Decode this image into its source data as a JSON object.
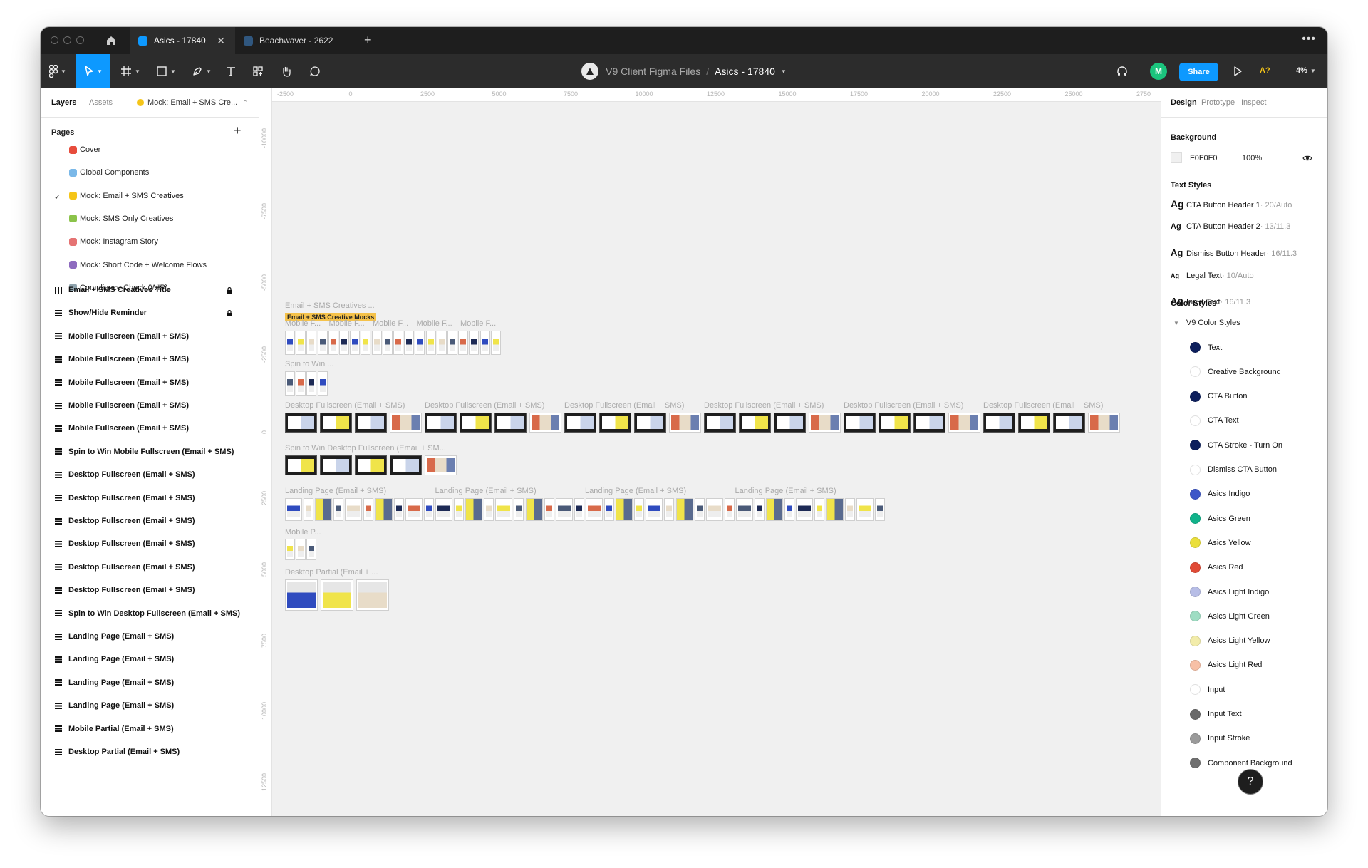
{
  "titlebar": {
    "tabs": [
      {
        "label": "Asics - 17840",
        "active": true
      },
      {
        "label": "Beachwaver - 2622",
        "active": false
      }
    ]
  },
  "header": {
    "project": "V9 Client Figma Files",
    "separator": "/",
    "file": "Asics - 17840",
    "avatar_initial": "M",
    "share_label": "Share",
    "a11y_label": "A?",
    "zoom": "4%"
  },
  "left_panel": {
    "tabs": [
      "Layers",
      "Assets"
    ],
    "current_page": "Mock: Email + SMS Cre...",
    "pages_title": "Pages",
    "pages": [
      {
        "label": "Cover",
        "emoji_color": "#e74c3c"
      },
      {
        "label": "Global Components",
        "emoji_color": "#7ab8e8"
      },
      {
        "label": "Mock: Email + SMS Creatives",
        "emoji_color": "#f5c518",
        "current": true
      },
      {
        "label": "Mock: SMS Only Creatives",
        "emoji_color": "#8bc34a"
      },
      {
        "label": "Mock: Instagram Story",
        "emoji_color": "#e57373"
      },
      {
        "label": "Mock: Short Code + Welcome Flows",
        "emoji_color": "#8e6bbf"
      },
      {
        "label": "Compliance Check (WIP)",
        "emoji_color": "#90a4ae"
      }
    ],
    "layers": [
      {
        "label": "Email + SMS Creatives Title",
        "locked": true,
        "icon": "columns"
      },
      {
        "label": "Show/Hide Reminder",
        "locked": true,
        "icon": "rows"
      },
      {
        "label": "Mobile Fullscreen (Email + SMS)",
        "icon": "rows"
      },
      {
        "label": "Mobile Fullscreen (Email + SMS)",
        "icon": "rows"
      },
      {
        "label": "Mobile Fullscreen (Email + SMS)",
        "icon": "rows"
      },
      {
        "label": "Mobile Fullscreen (Email + SMS)",
        "icon": "rows"
      },
      {
        "label": "Mobile Fullscreen (Email + SMS)",
        "icon": "rows"
      },
      {
        "label": "Spin to Win Mobile Fullscreen (Email + SMS)",
        "icon": "rows"
      },
      {
        "label": "Desktop Fullscreen (Email + SMS)",
        "icon": "rows"
      },
      {
        "label": "Desktop Fullscreen (Email + SMS)",
        "icon": "rows"
      },
      {
        "label": "Desktop Fullscreen (Email + SMS)",
        "icon": "rows"
      },
      {
        "label": "Desktop Fullscreen (Email + SMS)",
        "icon": "rows"
      },
      {
        "label": "Desktop Fullscreen (Email + SMS)",
        "icon": "rows"
      },
      {
        "label": "Desktop Fullscreen (Email + SMS)",
        "icon": "rows"
      },
      {
        "label": "Spin to Win Desktop Fullscreen (Email + SMS)",
        "icon": "rows"
      },
      {
        "label": "Landing Page (Email + SMS)",
        "icon": "rows"
      },
      {
        "label": "Landing Page (Email + SMS)",
        "icon": "rows"
      },
      {
        "label": "Landing Page (Email + SMS)",
        "icon": "rows"
      },
      {
        "label": "Landing Page (Email + SMS)",
        "icon": "rows"
      },
      {
        "label": "Mobile Partial (Email + SMS)",
        "icon": "rows"
      },
      {
        "label": "Desktop Partial (Email + SMS)",
        "icon": "rows"
      }
    ]
  },
  "canvas": {
    "ruler_top": [
      "-2500",
      "0",
      "2500",
      "5000",
      "7500",
      "10000",
      "12500",
      "15000",
      "17500",
      "20000",
      "22500",
      "25000",
      "2750"
    ],
    "ruler_left": [
      "-10000",
      "-7500",
      "-5000",
      "-2500",
      "0",
      "2500",
      "5000",
      "7500",
      "10000",
      "12500"
    ],
    "section_title": "Email + SMS Creatives ...",
    "section_tag": "Email + SMS Creative Mocks",
    "mobile_labels": [
      "Mobile F...",
      "Mobile F...",
      "Mobile F...",
      "Mobile F...",
      "Mobile F..."
    ],
    "spin_mobile_label": "Spin to Win ...",
    "desktop_labels": [
      "Desktop Fullscreen (Email + SMS)",
      "Desktop Fullscreen (Email + SMS)",
      "Desktop Fullscreen (Email + SMS)",
      "Desktop Fullscreen (Email + SMS)",
      "Desktop Fullscreen (Email + SMS)",
      "Desktop Fullscreen (Email + SMS)"
    ],
    "spin_desktop_label": "Spin to Win Desktop Fullscreen (Email + SM...",
    "landing_labels": [
      "Landing Page (Email + SMS)",
      "Landing Page (Email + SMS)",
      "Landing Page (Email + SMS)",
      "Landing Page (Email + SMS)"
    ],
    "mobile_partial_label": "Mobile P...",
    "desktop_partial_label": "Desktop Partial (Email + ..."
  },
  "right_panel": {
    "tabs": [
      "Design",
      "Prototype",
      "Inspect"
    ],
    "background_title": "Background",
    "background_hex": "F0F0F0",
    "background_opacity": "100%",
    "text_styles_title": "Text Styles",
    "text_styles": [
      {
        "sample": "Ag",
        "name": "CTA Button Header 1",
        "meta": " · 20/Auto",
        "size": 14
      },
      {
        "sample": "Ag",
        "name": "CTA Button Header 2",
        "meta": " · 13/11.3",
        "size": 11
      },
      {
        "sample": "Ag",
        "name": "Dismiss Button Header",
        "meta": " · 16/11.3",
        "size": 13
      },
      {
        "sample": "Ag",
        "name": "Legal Text",
        "meta": " · 10/Auto",
        "size": 9
      },
      {
        "sample": "Ag",
        "name": "Input Text",
        "meta": " · 16/11.3",
        "size": 13
      }
    ],
    "color_styles_title": "Color Styles",
    "color_group": "V9 Color Styles",
    "color_styles": [
      {
        "name": "Text",
        "color": "#0d1f5c"
      },
      {
        "name": "Creative Background",
        "color": "#ffffff"
      },
      {
        "name": "CTA Button",
        "color": "#0d1f5c"
      },
      {
        "name": "CTA Text",
        "color": "#ffffff"
      },
      {
        "name": "CTA Stroke - Turn On",
        "color": "#0d1f5c"
      },
      {
        "name": "Dismiss CTA Button",
        "color": "#ffffff"
      },
      {
        "name": "Asics Indigo",
        "color": "#3d57c8"
      },
      {
        "name": "Asics Green",
        "color": "#10b28a"
      },
      {
        "name": "Asics Yellow",
        "color": "#eadf3b"
      },
      {
        "name": "Asics Red",
        "color": "#e04a36"
      },
      {
        "name": "Asics Light Indigo",
        "color": "#b7bde6"
      },
      {
        "name": "Asics Light Green",
        "color": "#9fddc3"
      },
      {
        "name": "Asics Light Yellow",
        "color": "#f2ecaa"
      },
      {
        "name": "Asics Light Red",
        "color": "#f7c0a6"
      },
      {
        "name": "Input",
        "color": "#ffffff"
      },
      {
        "name": "Input Text",
        "color": "#6a6a6a"
      },
      {
        "name": "Input Stroke",
        "color": "#9a9a9a"
      },
      {
        "name": "Component Background",
        "color": "#6f6f6f"
      }
    ]
  },
  "help_label": "?"
}
